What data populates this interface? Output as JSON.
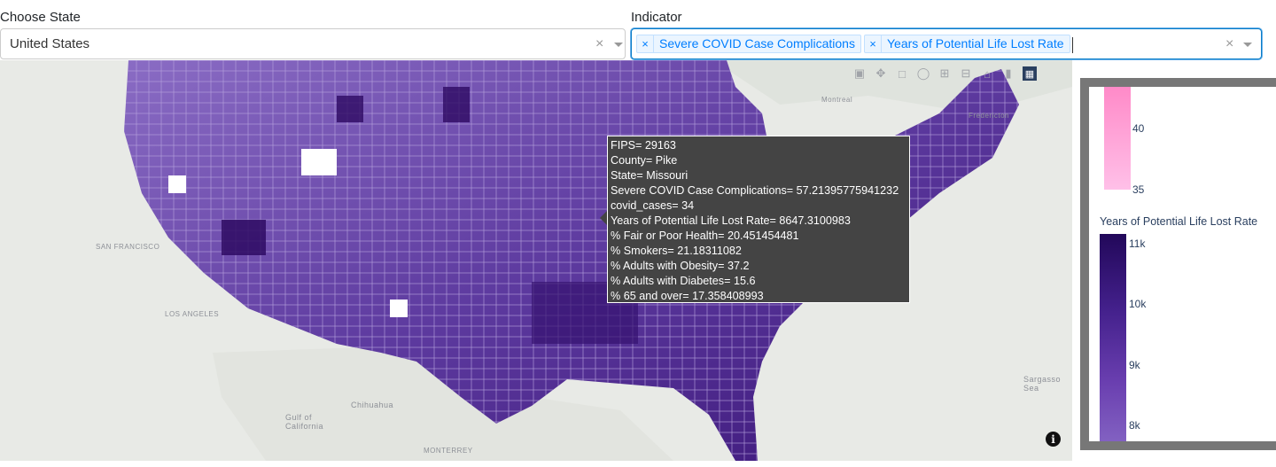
{
  "state_filter": {
    "label": "Choose State",
    "value": "United States"
  },
  "indicator_filter": {
    "label": "Indicator",
    "chips": [
      "Severe COVID Case Complications",
      "Years of Potential Life Lost Rate"
    ]
  },
  "map_labels": {
    "san_francisco": "SAN FRANCISCO",
    "los_angeles": "LOS ANGELES",
    "chihuahua": "Chihuahua",
    "gulf_california": "Gulf of California",
    "monterrey": "MONTERREY",
    "sargasso": "Sargasso Sea",
    "montreal": "Montreal",
    "fredericton": "Fredericton"
  },
  "tooltip": {
    "lines": [
      "FIPS= 29163",
      "County= Pike",
      "State= Missouri",
      "Severe COVID Case Complications= 57.21395775941232",
      "covid_cases= 34",
      "Years of Potential Life Lost Rate= 8647.3100983",
      "% Fair or Poor Health= 20.451454481",
      "% Smokers= 21.18311082",
      "% Adults with Obesity= 37.2",
      "% Adults with Diabetes= 15.6",
      "% 65 and over= 17.358408993"
    ]
  },
  "legend": {
    "covid_ticks": [
      "40",
      "35"
    ],
    "ypll_title": "Years of Potential Life Lost Rate",
    "ypll_ticks": [
      "11k",
      "10k",
      "9k",
      "8k"
    ],
    "colors": {
      "ypll_high": "#22085a",
      "ypll_low": "#8464c3",
      "covid_high": "#ff8ac8",
      "covid_low": "#ffc0e8"
    }
  },
  "modebar_icons": [
    "camera-icon",
    "pan-icon",
    "lasso-icon",
    "zoom-in-icon",
    "zoom-out-icon",
    "home-icon",
    "reset-icon",
    "plotly-logo-icon"
  ]
}
